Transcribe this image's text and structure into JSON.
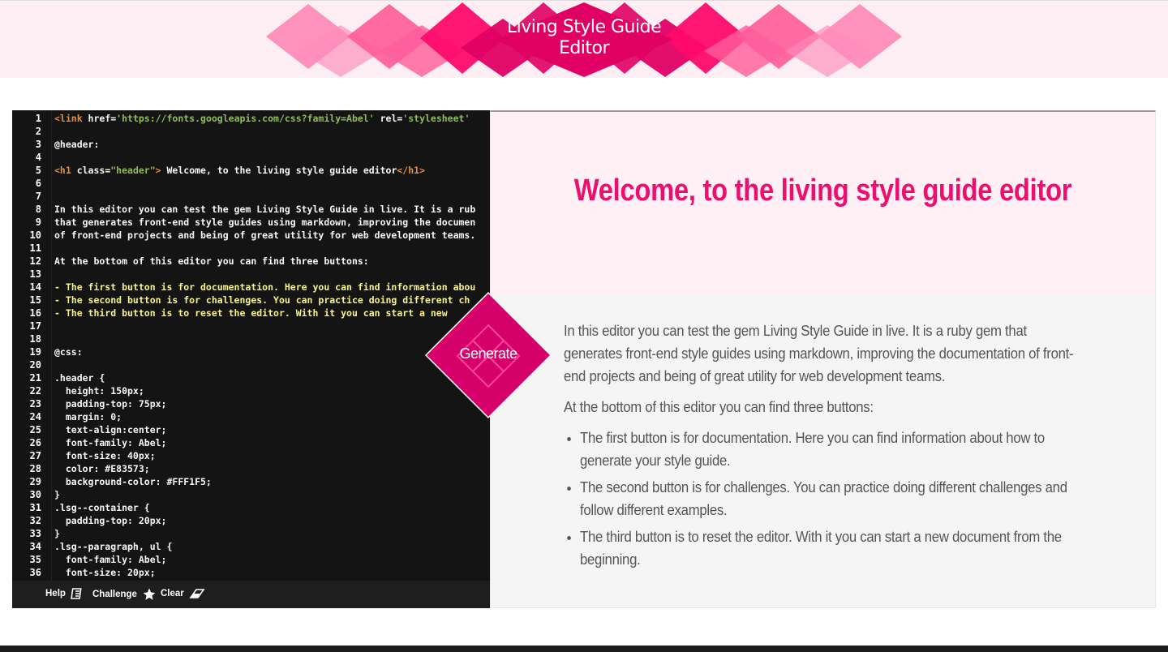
{
  "header": {
    "title_line1": "Living Style Guide",
    "title_line2": "Editor",
    "colors": [
      "#ff8cb8",
      "#ff5c98",
      "#ff0a6c",
      "#e00064"
    ]
  },
  "editor": {
    "lines": [
      {
        "n": "1",
        "spans": [
          [
            "tag",
            "<link "
          ],
          [
            "attr",
            "href="
          ],
          [
            "str",
            "'https://fonts.googleapis.com/css?family=Abel'"
          ],
          [
            "attr",
            " rel="
          ],
          [
            "str",
            "'stylesheet'"
          ],
          [
            "attr",
            " "
          ]
        ]
      },
      {
        "n": "2",
        "spans": []
      },
      {
        "n": "3",
        "spans": [
          [
            "attr",
            "@header:"
          ]
        ]
      },
      {
        "n": "4",
        "spans": []
      },
      {
        "n": "5",
        "spans": [
          [
            "tag",
            "<h1 "
          ],
          [
            "attr",
            "class="
          ],
          [
            "str",
            "\"header\""
          ],
          [
            "tag",
            ">"
          ],
          [
            "attr",
            " Welcome, to the living style guide editor"
          ],
          [
            "tag",
            "</h1>"
          ]
        ]
      },
      {
        "n": "6",
        "spans": []
      },
      {
        "n": "7",
        "spans": []
      },
      {
        "n": "8",
        "spans": [
          [
            "attr",
            "In this editor you can test the gem Living Style Guide in live. It is a rub"
          ]
        ]
      },
      {
        "n": "9",
        "spans": [
          [
            "attr",
            "that generates front-end style guides using markdown, improving the documen"
          ]
        ]
      },
      {
        "n": "10",
        "spans": [
          [
            "attr",
            "of front-end projects and being of great utility for web development teams."
          ]
        ]
      },
      {
        "n": "11",
        "spans": []
      },
      {
        "n": "12",
        "spans": [
          [
            "attr",
            "At the bottom of this editor you can find three buttons:"
          ]
        ]
      },
      {
        "n": "13",
        "spans": []
      },
      {
        "n": "14",
        "spans": [
          [
            "yellow",
            "- The first button is for documentation. Here you can find information abou"
          ]
        ]
      },
      {
        "n": "15",
        "spans": [
          [
            "yellow",
            "- The second button is for challenges. You can practice doing different ch"
          ]
        ]
      },
      {
        "n": "16",
        "spans": [
          [
            "yellow",
            "- The third button is to reset the editor. With it you can start a new"
          ]
        ]
      },
      {
        "n": "17",
        "spans": []
      },
      {
        "n": "18",
        "spans": []
      },
      {
        "n": "19",
        "spans": [
          [
            "attr",
            "@css:"
          ]
        ]
      },
      {
        "n": "20",
        "spans": []
      },
      {
        "n": "21",
        "spans": [
          [
            "attr",
            ".header {"
          ]
        ]
      },
      {
        "n": "22",
        "spans": [
          [
            "attr",
            "  height: 150px;"
          ]
        ]
      },
      {
        "n": "23",
        "spans": [
          [
            "attr",
            "  padding-top: 75px;"
          ]
        ]
      },
      {
        "n": "24",
        "spans": [
          [
            "attr",
            "  margin: 0;"
          ]
        ]
      },
      {
        "n": "25",
        "spans": [
          [
            "attr",
            "  text-align:center;"
          ]
        ]
      },
      {
        "n": "26",
        "spans": [
          [
            "attr",
            "  font-family: Abel;"
          ]
        ]
      },
      {
        "n": "27",
        "spans": [
          [
            "attr",
            "  font-size: 40px;"
          ]
        ]
      },
      {
        "n": "28",
        "spans": [
          [
            "attr",
            "  color: #E83573;"
          ]
        ]
      },
      {
        "n": "29",
        "spans": [
          [
            "attr",
            "  background-color: #FFF1F5;"
          ]
        ]
      },
      {
        "n": "30",
        "spans": [
          [
            "attr",
            "}"
          ]
        ]
      },
      {
        "n": "31",
        "spans": [
          [
            "attr",
            ".lsg--container {"
          ]
        ]
      },
      {
        "n": "32",
        "spans": [
          [
            "attr",
            "  padding-top: 20px;"
          ]
        ]
      },
      {
        "n": "33",
        "spans": [
          [
            "attr",
            "}"
          ]
        ]
      },
      {
        "n": "34",
        "spans": [
          [
            "attr",
            ".lsg--paragraph, ul {"
          ]
        ]
      },
      {
        "n": "35",
        "spans": [
          [
            "attr",
            "  font-family: Abel;"
          ]
        ]
      },
      {
        "n": "36",
        "spans": [
          [
            "attr",
            "  font-size: 20px;"
          ]
        ]
      }
    ],
    "toolbar": {
      "help_label": "Help",
      "challenge_label": "Challenge",
      "clear_label": "Clear"
    }
  },
  "generate": {
    "label": "Generate"
  },
  "preview": {
    "heading": "Welcome, to the living style guide editor",
    "paragraph1": "In this editor you can test the gem Living Style Guide in live. It is a ruby gem that generates front-end style guides using markdown, improving the documentation of front-end projects and being of great utility for web development teams.",
    "paragraph2": "At the bottom of this editor you can find three buttons:",
    "items": [
      "The first button is for documentation. Here you can find information about how to generate your style guide.",
      "The second button is for challenges. You can practice doing different challenges and follow different examples.",
      "The third button is to reset the editor. With it you can start a new document from the beginning."
    ]
  }
}
